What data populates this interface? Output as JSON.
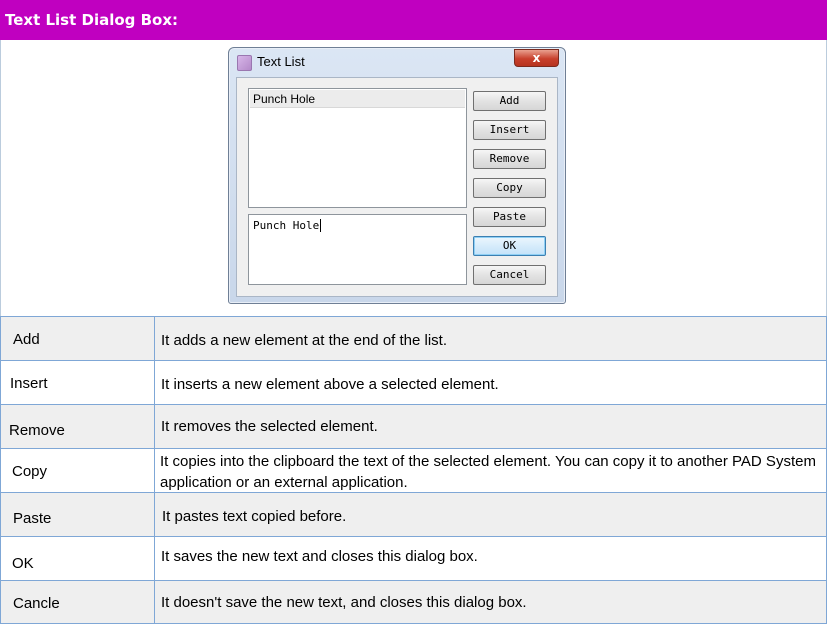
{
  "header": {
    "title": "Text List Dialog Box:"
  },
  "dialog": {
    "title": "Text List",
    "close_label": "x",
    "list_items": [
      "Punch Hole"
    ],
    "edit_value": "Punch Hole",
    "buttons": {
      "add": "Add",
      "insert": "Insert",
      "remove": "Remove",
      "copy": "Copy",
      "paste": "Paste",
      "ok": "OK",
      "cancel": "Cancel"
    }
  },
  "table": {
    "rows": [
      {
        "term": "Add",
        "description": "It adds a new element at the end of the list."
      },
      {
        "term": "Insert",
        "description": "It inserts a new element above a selected element."
      },
      {
        "term": "Remove",
        "description": "It removes the selected element."
      },
      {
        "term": "Copy",
        "description": "It copies into the clipboard the text of the selected element. You can copy it to another PAD System application or an external application."
      },
      {
        "term": "Paste",
        "description": "It pastes text copied before."
      },
      {
        "term": "OK",
        "description": "It saves the new text and closes this dialog box."
      },
      {
        "term": "Cancle",
        "description": "It doesn't save the new text,  and closes this dialog box."
      }
    ]
  },
  "colors": {
    "header_bg": "#c000c0",
    "table_border": "#7fa7d6",
    "row_alt_bg": "#efefef"
  }
}
